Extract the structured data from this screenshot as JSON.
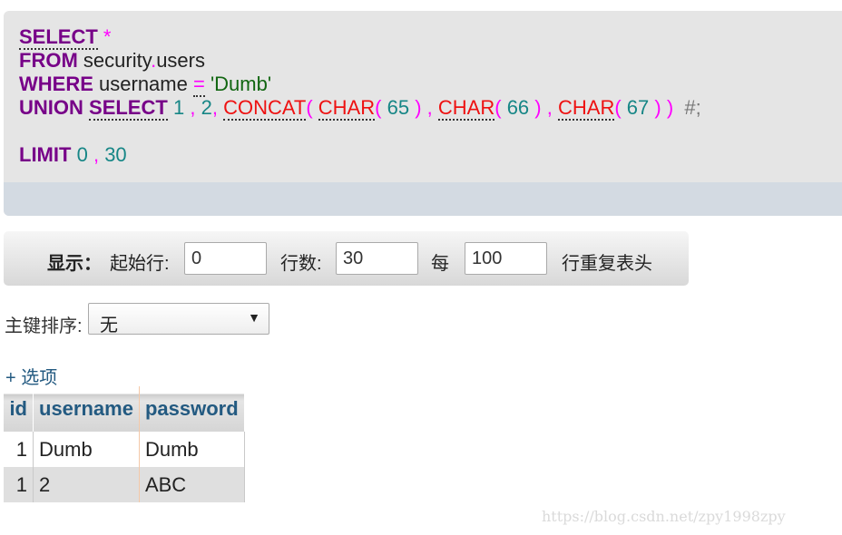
{
  "sql": {
    "select_kw": "SELECT",
    "star": "*",
    "from_kw": "FROM",
    "schema": "security",
    "dot": ".",
    "table": "users",
    "where_kw": "WHERE",
    "column": "username",
    "eq": "=",
    "value": "'Dumb'",
    "union_kw": "UNION",
    "select2_kw": "SELECT",
    "n1": "1",
    "n2": "2",
    "concat_fn": "CONCAT",
    "char_fn": "CHAR",
    "c1": "65",
    "c2": "66",
    "c3": "67",
    "comment": "#;",
    "limit_kw": "LIMIT",
    "limit_start": "0",
    "limit_count": "30",
    "comma": ",",
    "lparen": "(",
    "rparen": ")"
  },
  "nav": {
    "show_label": "显示：",
    "start_row_label": "起始行:",
    "start_row_value": "0",
    "num_rows_label": "行数:",
    "num_rows_value": "30",
    "every_label": "每",
    "repeat_value": "100",
    "repeat_header_label": "行重复表头"
  },
  "sort": {
    "label": "主键排序:",
    "selected": "无"
  },
  "options_link": "+ 选项",
  "table": {
    "headers": [
      "id",
      "username",
      "password"
    ],
    "rows": [
      [
        "1",
        "Dumb",
        "Dumb"
      ],
      [
        "1",
        "2",
        "ABC"
      ]
    ]
  },
  "watermark": "https://blog.csdn.net/zpy1998zpy"
}
